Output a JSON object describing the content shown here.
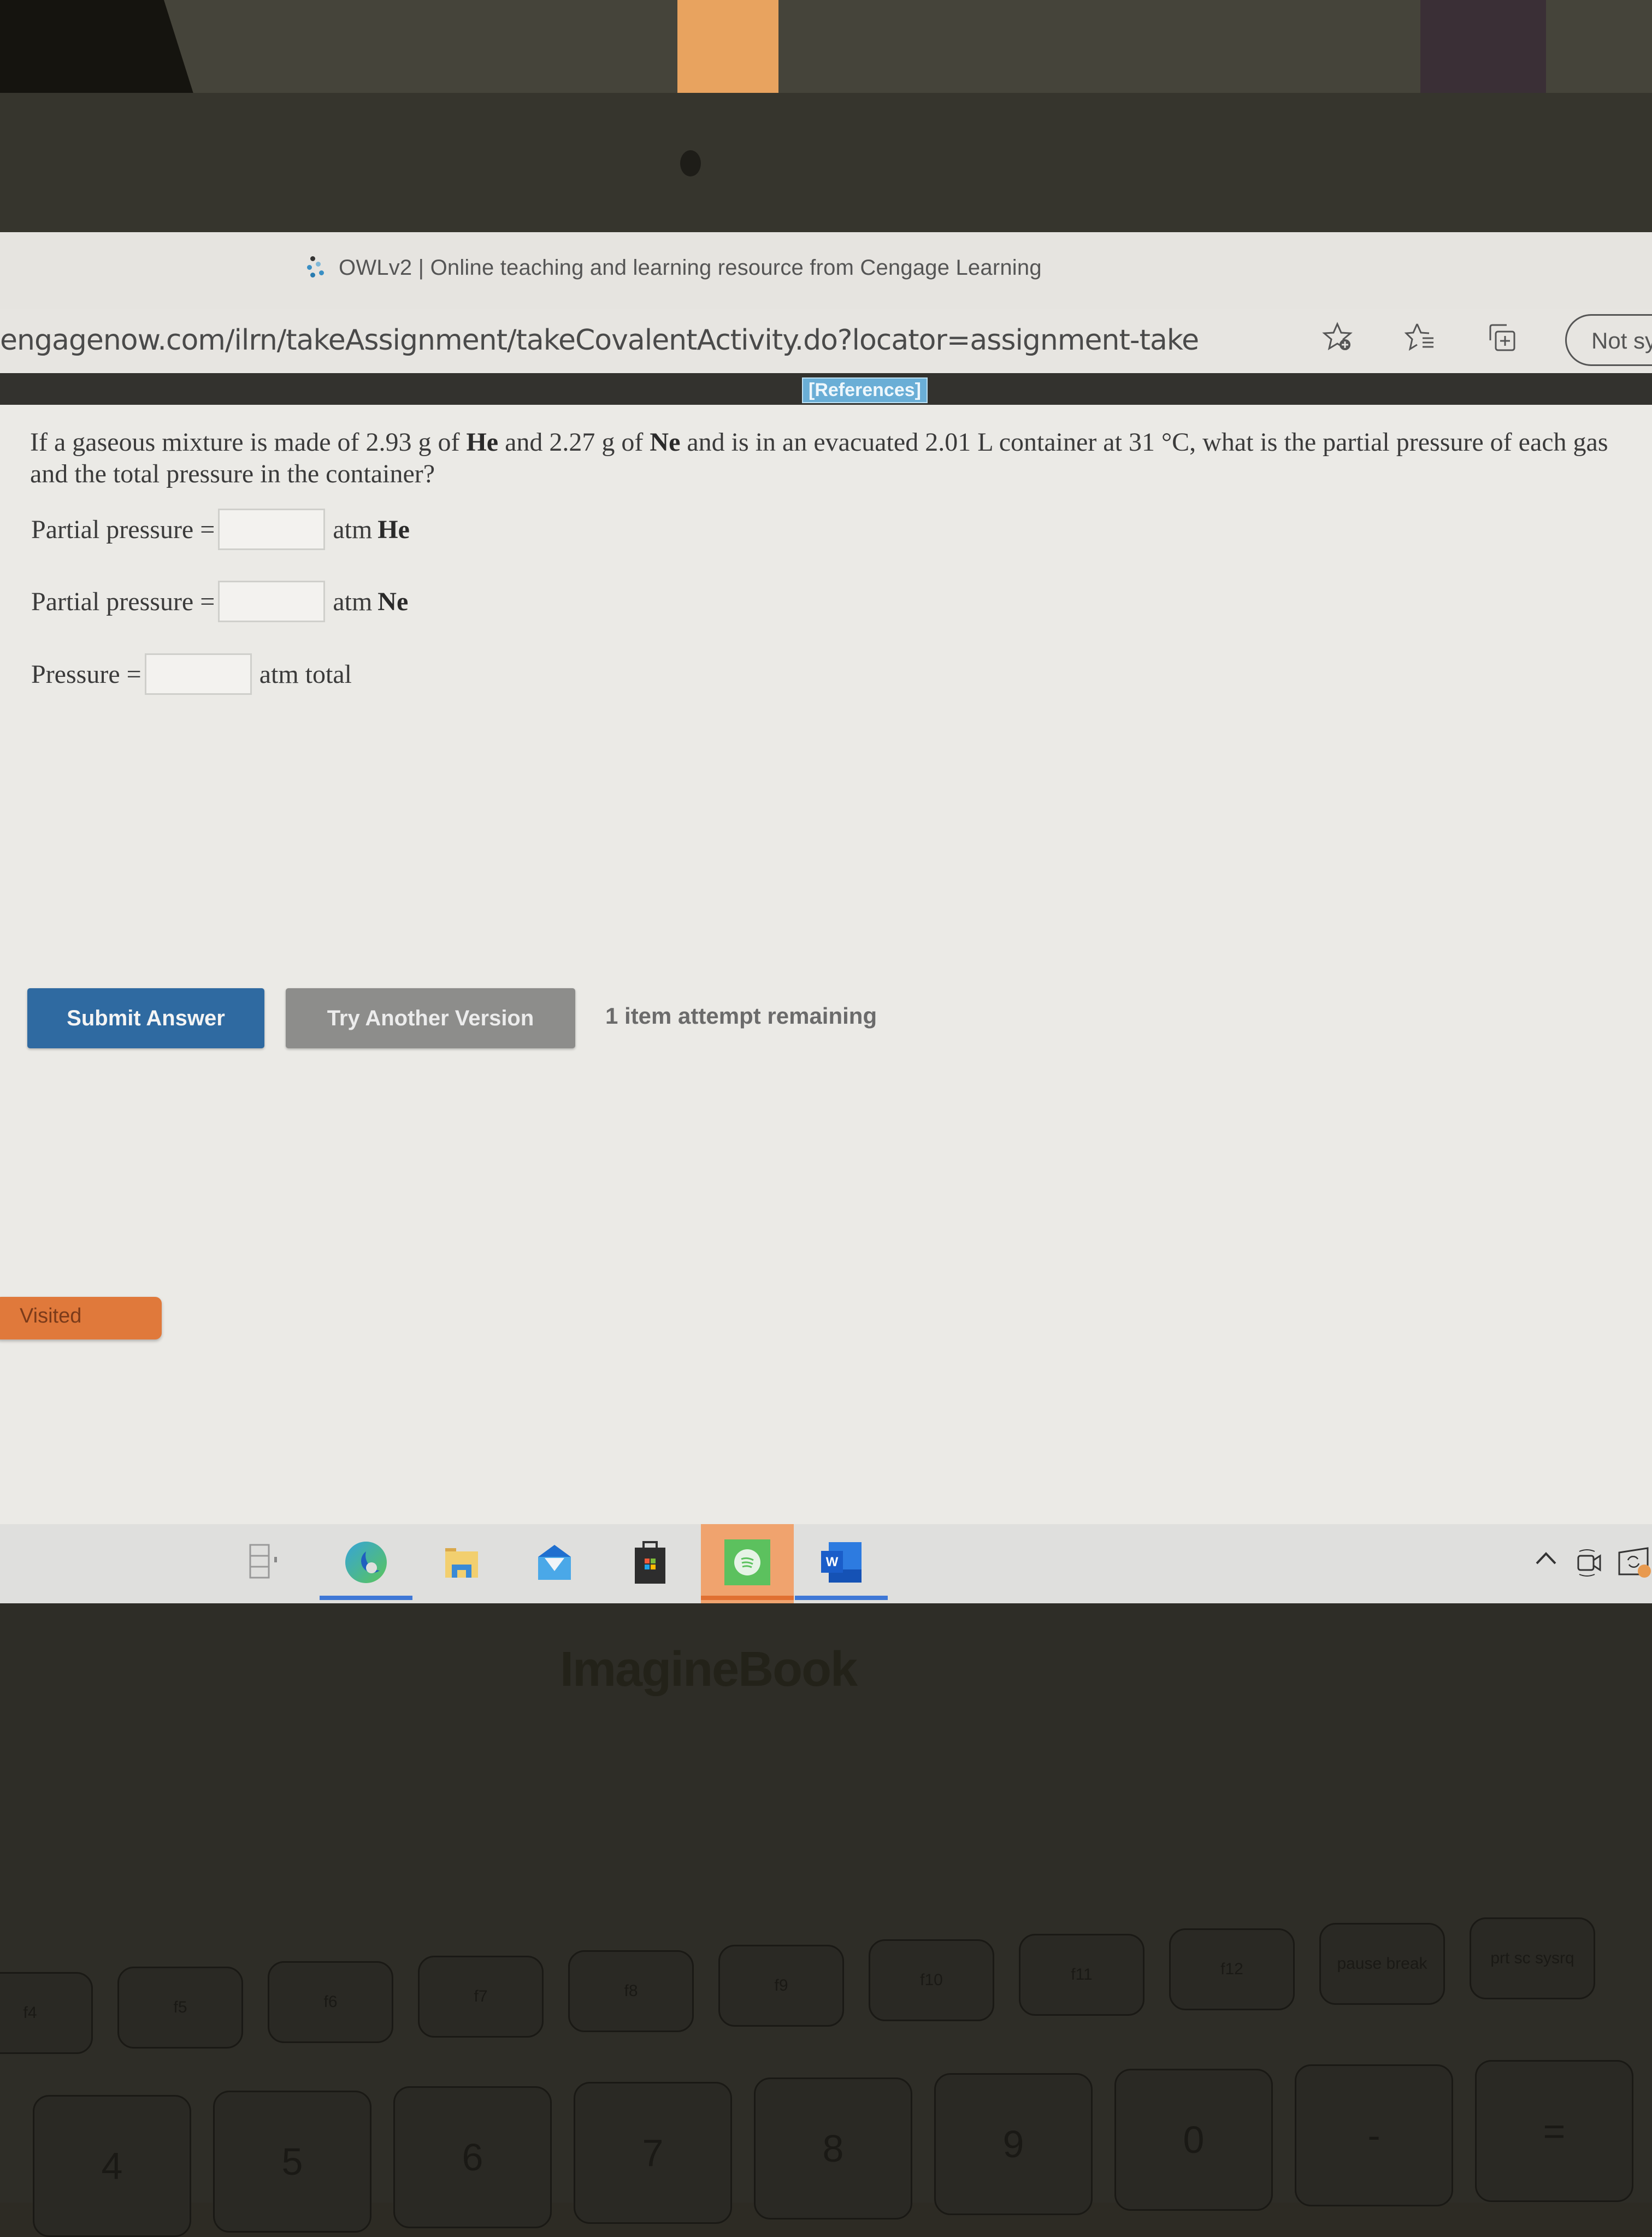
{
  "browser": {
    "page_title": "OWLv2 | Online teaching and learning resource from Cengage Learning",
    "url": "engagenow.com/ilrn/takeAssignment/takeCovalentActivity.do?locator=assignment-take",
    "sync_button_label": "Not sy",
    "icons": [
      "add-favorite-icon",
      "favorites-icon",
      "collections-icon"
    ]
  },
  "references_link": "[References]",
  "question": {
    "text_parts": [
      "If a gaseous mixture is made of 2.93 g of ",
      "He",
      " and 2.27 g of ",
      "Ne",
      " and is in an evacuated 2.01 L container at 31 °C, what is the partial pressure of each gas and the total pressure in the container?"
    ],
    "mass_he_g": 2.93,
    "mass_ne_g": 2.27,
    "volume_L": 2.01,
    "temperature_C": 31
  },
  "answers": [
    {
      "label": "Partial pressure =",
      "value": "",
      "unit": "atm",
      "species": "He"
    },
    {
      "label": "Partial pressure =",
      "value": "",
      "unit": "atm",
      "species": "Ne"
    },
    {
      "label": "Pressure =",
      "value": "",
      "unit": "atm total",
      "species": ""
    }
  ],
  "actions": {
    "submit_label": "Submit Answer",
    "try_another_label": "Try Another Version",
    "attempts_text": "1 item attempt remaining"
  },
  "visited_tab_label": "Visited",
  "taskbar": {
    "items": [
      {
        "name": "task-view",
        "active": false
      },
      {
        "name": "edge",
        "active": true
      },
      {
        "name": "file-explorer",
        "active": false
      },
      {
        "name": "mail",
        "active": false
      },
      {
        "name": "microsoft-store",
        "active": false
      },
      {
        "name": "spotify",
        "active": true,
        "highlighted": true
      },
      {
        "name": "word",
        "active": true
      }
    ],
    "tray": [
      "show-hidden-icons",
      "meet-now",
      "notification"
    ]
  },
  "laptop": {
    "brand": "ImagineBook",
    "fkeys": [
      "f4",
      "f5",
      "f6",
      "f7",
      "f8",
      "f9",
      "f10",
      "f11",
      "f12",
      "pause break",
      "prt sc sysrq"
    ],
    "number_keys": [
      "4",
      "5",
      "6",
      "7",
      "8",
      "9",
      "0",
      "-",
      "="
    ]
  },
  "colors": {
    "submit": "#2f6aa1",
    "try_another": "#8d8d8b",
    "visited": "#e0793b",
    "references": "#6aaed6"
  }
}
